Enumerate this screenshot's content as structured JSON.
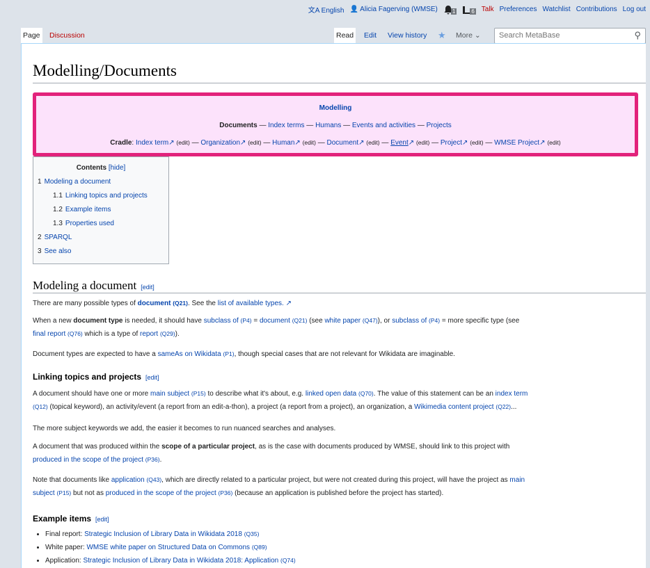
{
  "personal": {
    "language": "English",
    "user": "Alicia Fagerving (WMSE)",
    "alerts_count": "1",
    "notices_count": "6",
    "talk": "Talk",
    "preferences": "Preferences",
    "watchlist": "Watchlist",
    "contributions": "Contributions",
    "logout": "Log out"
  },
  "tabs": {
    "page": "Page",
    "discussion": "Discussion",
    "read": "Read",
    "edit": "Edit",
    "view_history": "View history",
    "more": "More",
    "search_placeholder": "Search MetaBase"
  },
  "title": "Modelling/Documents",
  "navbox": {
    "heading": "Modelling",
    "row2": {
      "current": "Documents",
      "links": [
        "Index terms",
        "Humans",
        "Events and activities",
        "Projects"
      ]
    },
    "cradle_label": "Cradle",
    "cradle_items": [
      "Index term",
      "Organization",
      "Human",
      "Document",
      "Event",
      "Project",
      "WMSE Project"
    ],
    "edit": "(edit)",
    "sep": "—"
  },
  "toc": {
    "title": "Contents",
    "hide": "[hide]",
    "items": [
      {
        "num": "1",
        "label": "Modeling a document"
      },
      {
        "num": "1.1",
        "label": "Linking topics and projects"
      },
      {
        "num": "1.2",
        "label": "Example items"
      },
      {
        "num": "1.3",
        "label": "Properties used"
      },
      {
        "num": "2",
        "label": "SPARQL"
      },
      {
        "num": "3",
        "label": "See also"
      }
    ]
  },
  "sections": {
    "s1": {
      "title": "Modeling a document",
      "edit": "[edit]"
    },
    "s11": {
      "title": "Linking topics and projects",
      "edit": "[edit]"
    },
    "s12": {
      "title": "Example items",
      "edit": "[edit]"
    }
  },
  "para1": {
    "a": "There are many possible types of ",
    "b": "document",
    "c": "(Q21)",
    "d": ". See the ",
    "e": "list of available types."
  },
  "para2": {
    "a": "When a new ",
    "b": "document type",
    "c": " is needed, it should have ",
    "d": "subclass of",
    "e": "(P4)",
    "f": " = ",
    "g": "document",
    "h": "(Q21)",
    "i": " (see ",
    "j": "white paper",
    "k": "(Q47)",
    "l": "), or ",
    "m": "subclass of",
    "n": "(P4)",
    "o": " = more specific type (see",
    "p": "final report",
    "q": "(Q76)",
    "r": " which is a type of ",
    "s": "report",
    "t": "(Q29)",
    "u": ")."
  },
  "para3": {
    "a": "Document types are expected to have a ",
    "b": "sameAs on Wikidata",
    "c": "(P1)",
    "d": ", though special cases that are not relevant for Wikidata are imaginable."
  },
  "para4": {
    "a": "A document should have one or more ",
    "b": "main subject",
    "c": "(P15)",
    "d": " to describe what it's about, e.g. ",
    "e": "linked open data",
    "f": "(Q70)",
    "g": ". The value of this statement can be an ",
    "h": "index term",
    "i": "(Q12)",
    "j": " (topical keyword), an activity/event (a report from an edit-a-thon), a project (a report from a project), an organization, a ",
    "k": "Wikimedia content project",
    "l": "(Q22)",
    "m": "..."
  },
  "para5": "The more subject keywords we add, the easier it becomes to run nuanced searches and analyses.",
  "para6": {
    "a": "A document that was produced within the ",
    "b": "scope of a particular project",
    "c": ", as is the case with documents produced by WMSE, should link to this project with",
    "d": "produced in the scope of the project",
    "e": "(P36)",
    "f": "."
  },
  "para7": {
    "a": "Note that documents like ",
    "b": "application",
    "c": "(Q43)",
    "d": ", which are directly related to a particular project, but were not created during this project, will have the project as ",
    "e": "main",
    "f": "subject",
    "g": "(P15)",
    "h": " but not as ",
    "i": "produced in the scope of the project",
    "j": "(P36)",
    "k": " (because an application is published before the project has started)."
  },
  "examples": [
    {
      "label": "Final report: ",
      "link": "Strategic Inclusion of Library Data in Wikidata 2018",
      "q": "(Q35)"
    },
    {
      "label": "White paper: ",
      "link": "WMSE white paper on Structured Data on Commons",
      "q": "(Q89)"
    },
    {
      "label": "Application: ",
      "link": "Strategic Inclusion of Library Data in Wikidata 2018: Application",
      "q": "(Q74)"
    }
  ],
  "colors": {
    "navbox_border": "#e2227b",
    "navbox_bg": "#fce2fb",
    "link": "#0645ad",
    "redlink": "#ba0000"
  }
}
